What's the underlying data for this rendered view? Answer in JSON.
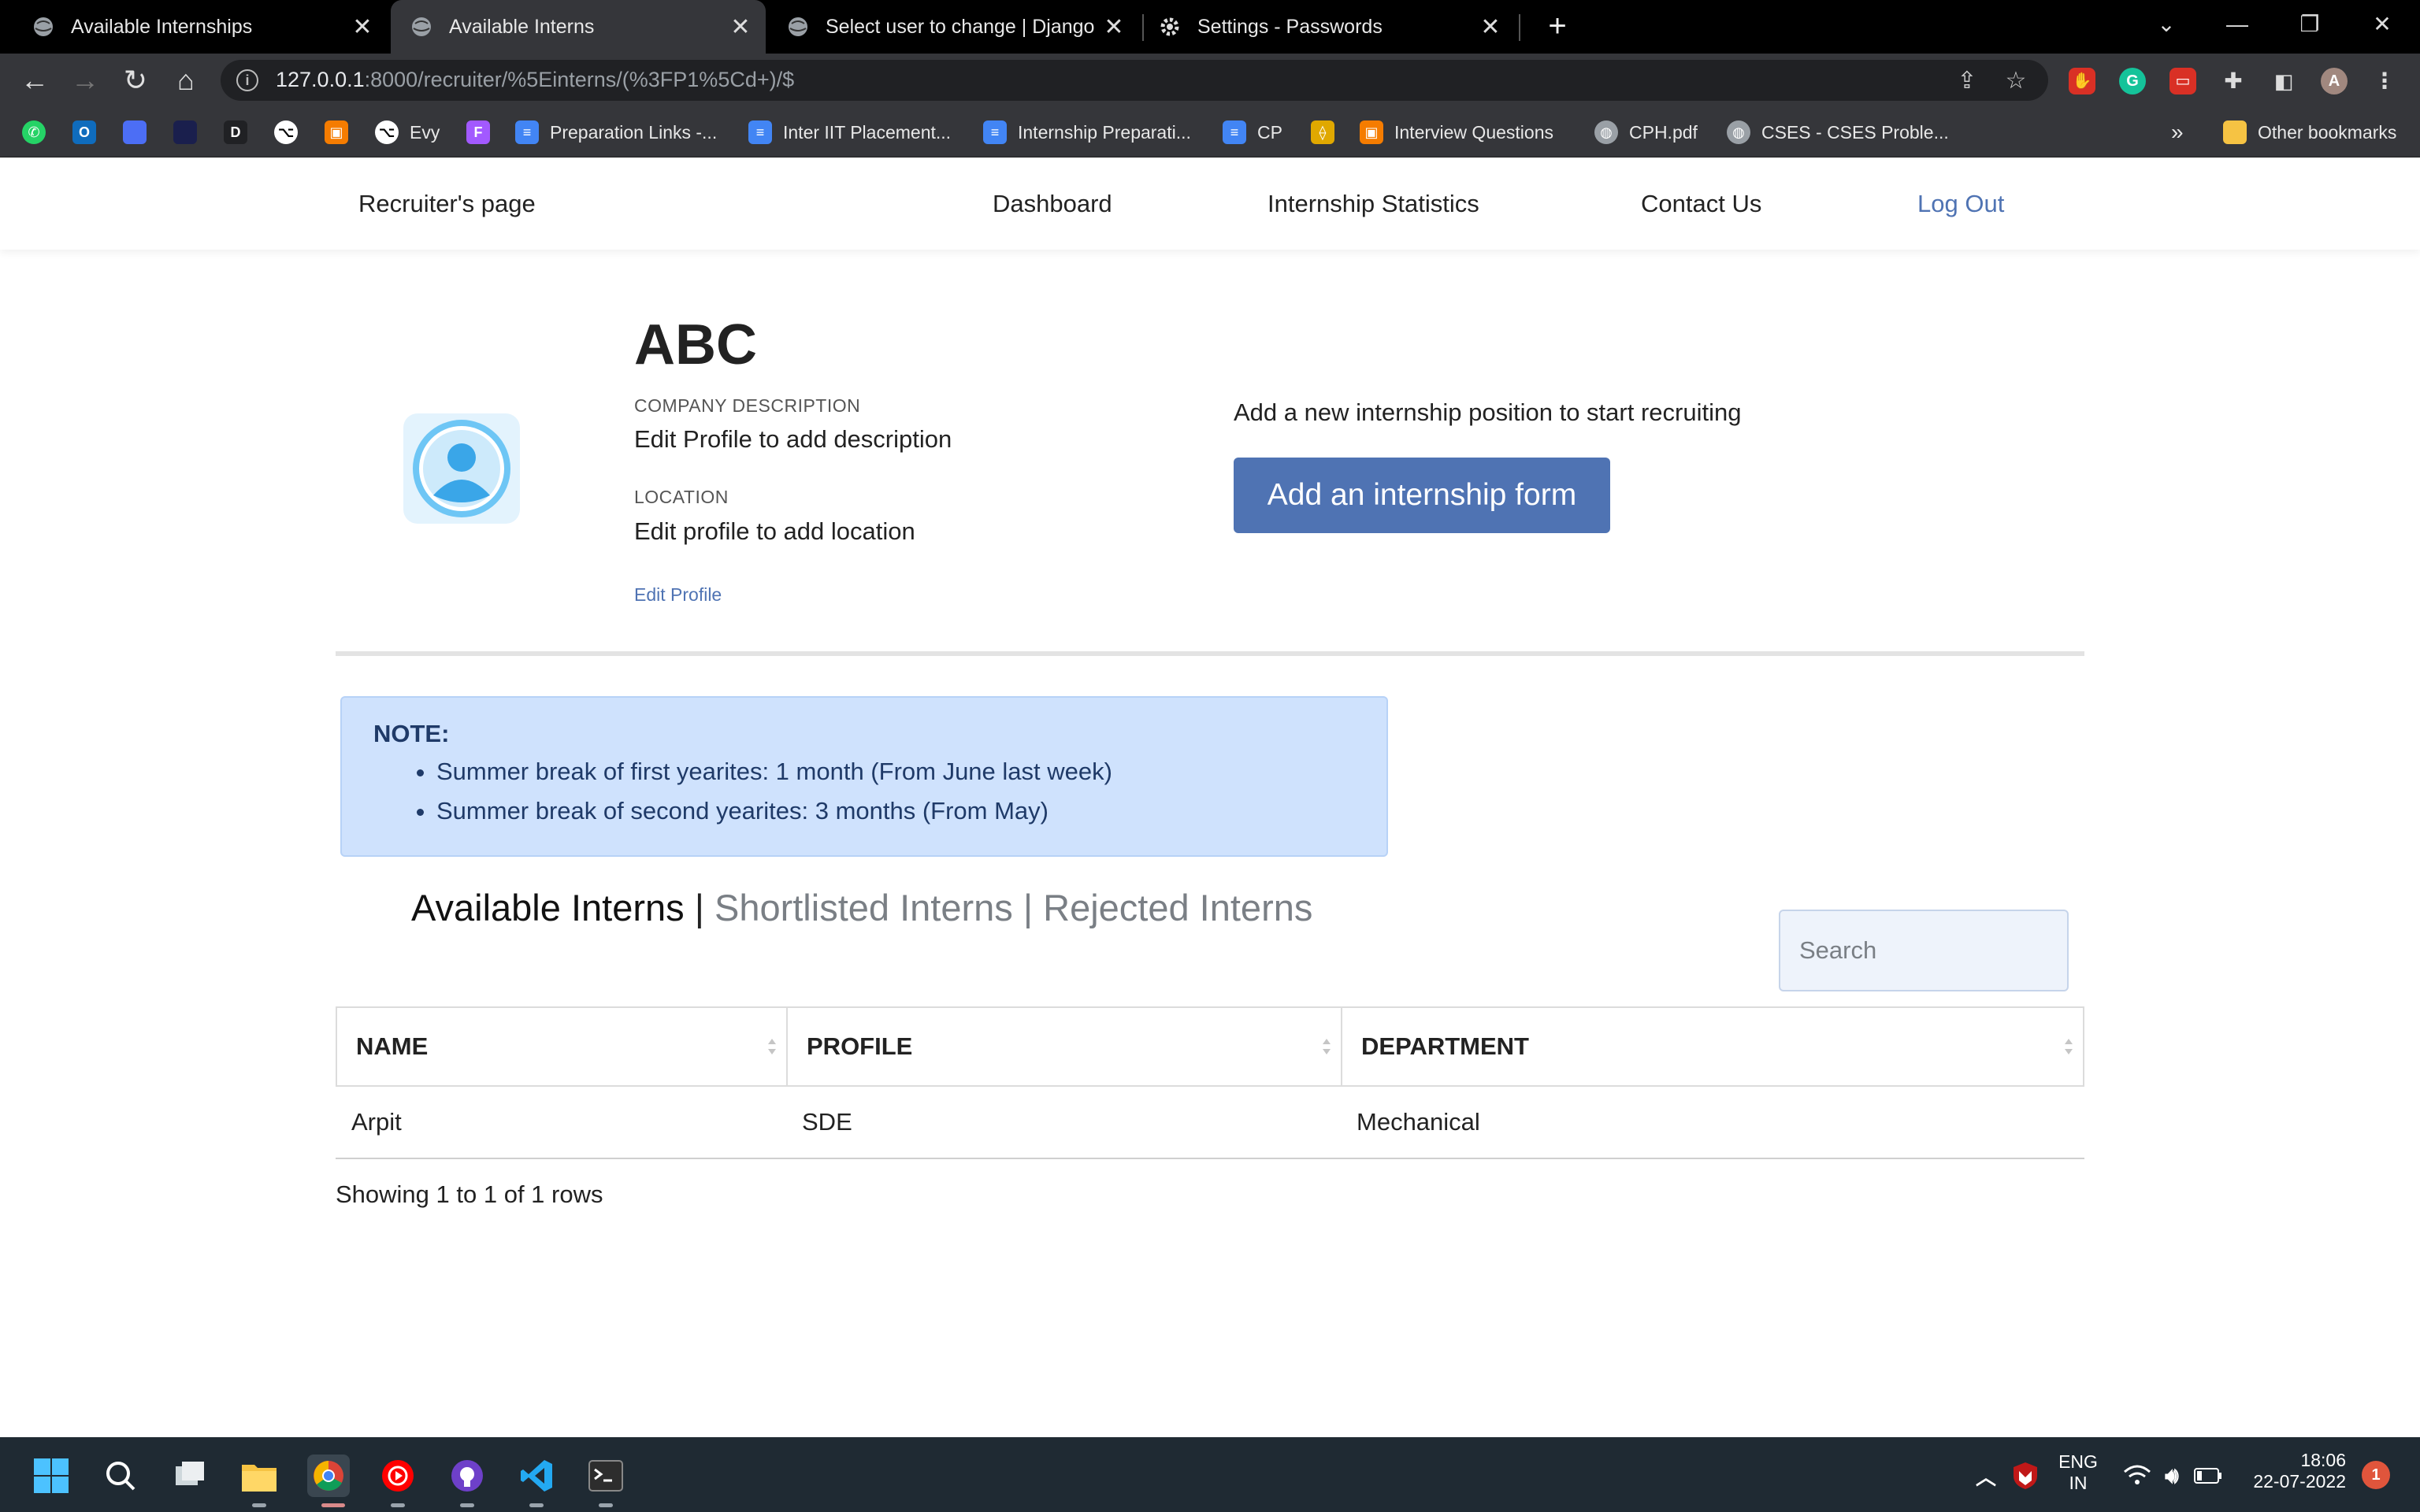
{
  "browser": {
    "tabs": [
      {
        "title": "Available Internships",
        "close": "✕"
      },
      {
        "title": "Available Interns",
        "close": "✕"
      },
      {
        "title": "Select user to change | Django si",
        "close": "✕"
      },
      {
        "title": "Settings - Passwords",
        "close": "✕"
      }
    ],
    "new_tab": "+",
    "url_host": "127.0.0.1",
    "url_path": ":8000/recruiter/%5Einterns/(%3FP1%5Cd+)/$",
    "bookmarks": [
      {
        "label": "",
        "icon": "whatsapp-icon"
      },
      {
        "label": "",
        "icon": "outlook-icon"
      },
      {
        "label": "",
        "icon": "app-icon"
      },
      {
        "label": "",
        "icon": "app-icon"
      },
      {
        "label": "",
        "icon": "d-icon"
      },
      {
        "label": "",
        "icon": "github-icon"
      },
      {
        "label": "",
        "icon": "app-icon"
      },
      {
        "label": "Evy",
        "icon": "github-icon"
      },
      {
        "label": "",
        "icon": "figma-icon"
      },
      {
        "label": "Preparation Links -...",
        "icon": "docs-icon"
      },
      {
        "label": "Inter IIT Placement...",
        "icon": "docs-icon"
      },
      {
        "label": "Internship Preparati...",
        "icon": "docs-icon"
      },
      {
        "label": "CP",
        "icon": "docs-icon"
      },
      {
        "label": "",
        "icon": "app-icon"
      },
      {
        "label": "Interview Questions",
        "icon": "app-icon"
      },
      {
        "label": "CPH.pdf",
        "icon": "globe-icon"
      },
      {
        "label": "CSES - CSES Proble...",
        "icon": "globe-icon"
      }
    ],
    "more_bookmarks": "»",
    "other_bookmarks": "Other bookmarks",
    "profile_initial": "A"
  },
  "navbar": {
    "brand": "Recruiter's page",
    "links": [
      "Dashboard",
      "Internship Statistics",
      "Contact Us"
    ],
    "logout": "Log Out"
  },
  "profile": {
    "company_name": "ABC",
    "description_label": "COMPANY DESCRIPTION",
    "description_value": "Edit Profile to add description",
    "location_label": "LOCATION",
    "location_value": "Edit profile to add location",
    "edit_link": "Edit Profile"
  },
  "add_section": {
    "hint": "Add a new internship position to start recruiting",
    "button": "Add an internship form"
  },
  "note": {
    "title": "NOTE:",
    "items": [
      "Summer break of first yearites: 1 month (From June last week)",
      "Summer break of second yearites: 3 months (From May)"
    ]
  },
  "intern_tabs": {
    "active": "Available Interns",
    "separator": "|",
    "shortlisted": "Shortlisted Interns",
    "rejected": "Rejected Interns"
  },
  "search": {
    "placeholder": "Search"
  },
  "table": {
    "columns": [
      "NAME",
      "PROFILE",
      "DEPARTMENT"
    ],
    "rows": [
      [
        "Arpit",
        "SDE",
        "Mechanical"
      ]
    ],
    "footer": "Showing 1 to 1 of 1 rows"
  },
  "taskbar": {
    "lang_top": "ENG",
    "lang_bottom": "IN",
    "time": "18:06",
    "date": "22-07-2022",
    "notification_count": "1"
  },
  "colors": {
    "accent": "#4f73b3",
    "note_bg": "#cfe2fd",
    "note_text": "#1f3a68"
  }
}
